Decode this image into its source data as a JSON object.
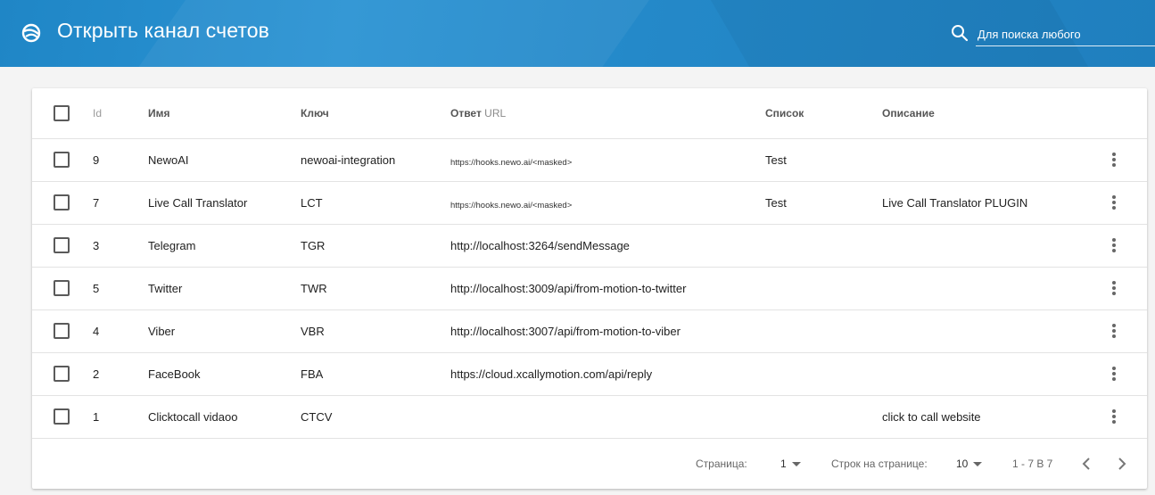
{
  "header": {
    "title": "Открыть канал счетов",
    "search_placeholder": "Для поиска любого",
    "logo_icon": "globe-logo-icon",
    "search_icon": "search-icon"
  },
  "table": {
    "columns": {
      "id": "Id",
      "name": "Имя",
      "key": "Ключ",
      "url_main": "Ответ",
      "url_suffix": "URL",
      "list": "Список",
      "description": "Описание"
    },
    "rows": [
      {
        "id": "9",
        "name": "NewoAI",
        "key": "newoai-integration",
        "url": "https://hooks.newo.ai/<masked>",
        "list": "Test",
        "description": ""
      },
      {
        "id": "7",
        "name": "Live Call Translator",
        "key": "LCT",
        "url": "https://hooks.newo.ai/<masked>",
        "list": "Test",
        "description": "Live Call Translator PLUGIN"
      },
      {
        "id": "3",
        "name": "Telegram",
        "key": "TGR",
        "url": "http://localhost:3264/sendMessage",
        "list": "",
        "description": ""
      },
      {
        "id": "5",
        "name": "Twitter",
        "key": "TWR",
        "url": "http://localhost:3009/api/from-motion-to-twitter",
        "list": "",
        "description": ""
      },
      {
        "id": "4",
        "name": "Viber",
        "key": "VBR",
        "url": "http://localhost:3007/api/from-motion-to-viber",
        "list": "",
        "description": ""
      },
      {
        "id": "2",
        "name": "FaceBook",
        "key": "FBA",
        "url": "https://cloud.xcallymotion.com/api/reply",
        "list": "",
        "description": ""
      },
      {
        "id": "1",
        "name": "Clicktocall vidaoo",
        "key": "CTCV",
        "url": "",
        "list": "",
        "description": "click to call website"
      }
    ]
  },
  "pagination": {
    "page_label": "Страница:",
    "page_value": "1",
    "rows_label": "Строк на странице:",
    "rows_value": "10",
    "range": "1 - 7 В 7"
  },
  "colors": {
    "header_bg": "#2389c9",
    "card_bg": "#ffffff",
    "page_bg": "#f4f4f4"
  }
}
